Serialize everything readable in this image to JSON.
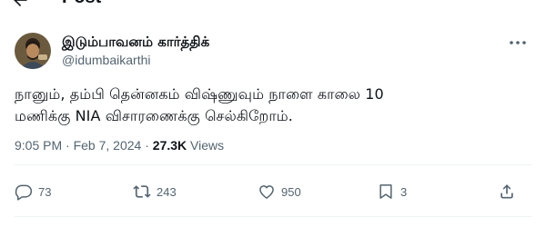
{
  "topbar": {
    "title": "Post"
  },
  "author": {
    "name": "இடும்பாவனம் கார்த்திக்",
    "handle": "@idumbaikarthi"
  },
  "tweet": {
    "text_line1": "நானும், தம்பி தென்னகம் விஷ்ணுவும் நாளை காலை 10",
    "text_line2": "மணிக்கு NIA விசாரணைக்கு செல்கிறோம்."
  },
  "meta": {
    "time": "9:05 PM",
    "separator": "·",
    "date": "Feb 7, 2024",
    "views_count": "27.3K",
    "views_label": "Views"
  },
  "actions": {
    "replies": "73",
    "reposts": "243",
    "likes": "950",
    "bookmarks": "3"
  },
  "colors": {
    "text": "#0f1419",
    "secondary": "#536471",
    "divider": "#eff3f4"
  },
  "icons": [
    "back-arrow-icon",
    "more-icon",
    "reply-icon",
    "repost-icon",
    "like-icon",
    "bookmark-icon",
    "share-icon"
  ]
}
